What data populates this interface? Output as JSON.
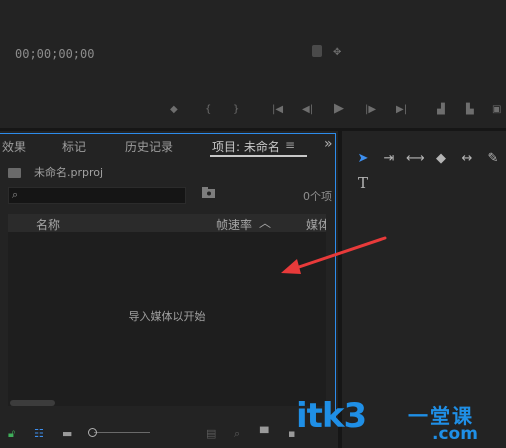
{
  "monitor": {
    "timecode": "00;00;00;00"
  },
  "project_panel": {
    "tabs": [
      {
        "label": "效果"
      },
      {
        "label": "标记"
      },
      {
        "label": "历史记录"
      },
      {
        "label": "项目: 未命名"
      }
    ],
    "overflow": "»",
    "file_name": "未命名.prproj",
    "item_count": "0个项",
    "columns": [
      "名称",
      "帧速率",
      "媒体"
    ],
    "empty_hint": "导入媒体以开始"
  },
  "tools_panel": {
    "type_tool_label": "T"
  },
  "watermark": {
    "brand": "itk3",
    "suffix": "一堂课",
    "domain": ".com"
  },
  "colors": {
    "accent": "#2d8ceb",
    "arrow": "#e83a3a",
    "watermark": "#1f8fe6"
  }
}
